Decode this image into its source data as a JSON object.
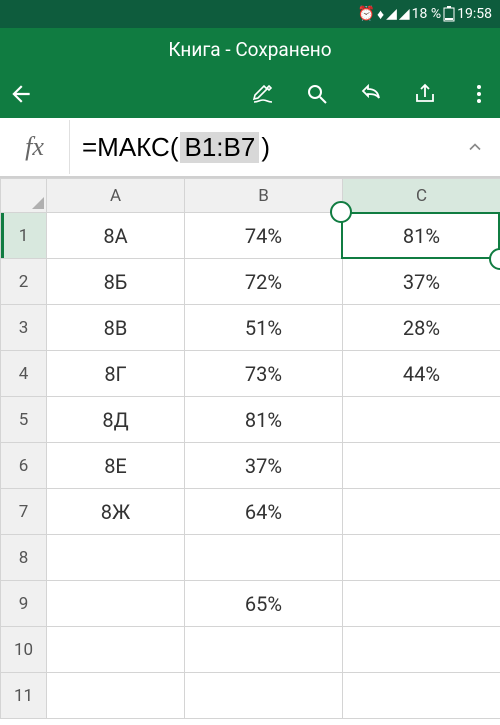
{
  "status": {
    "battery_pct": "18 %",
    "time": "19:58"
  },
  "header": {
    "title": "Книга - Сохранено"
  },
  "formula": {
    "fx_label": "fx",
    "prefix": "=МАКС(",
    "range": "B1:B7",
    "suffix": ")"
  },
  "columns": [
    "A",
    "B",
    "C"
  ],
  "rows": [
    {
      "n": "1",
      "a": "8А",
      "b": "74%",
      "c": "81%"
    },
    {
      "n": "2",
      "a": "8Б",
      "b": "72%",
      "c": "37%"
    },
    {
      "n": "3",
      "a": "8В",
      "b": "51%",
      "c": "28%"
    },
    {
      "n": "4",
      "a": "8Г",
      "b": "73%",
      "c": "44%"
    },
    {
      "n": "5",
      "a": "8Д",
      "b": "81%",
      "c": ""
    },
    {
      "n": "6",
      "a": "8Е",
      "b": "37%",
      "c": ""
    },
    {
      "n": "7",
      "a": "8Ж",
      "b": "64%",
      "c": ""
    },
    {
      "n": "8",
      "a": "",
      "b": "",
      "c": ""
    },
    {
      "n": "9",
      "a": "",
      "b": "65%",
      "c": ""
    },
    {
      "n": "10",
      "a": "",
      "b": "",
      "c": ""
    },
    {
      "n": "11",
      "a": "",
      "b": "",
      "c": ""
    }
  ],
  "selection": {
    "col": "C",
    "row": 1
  }
}
